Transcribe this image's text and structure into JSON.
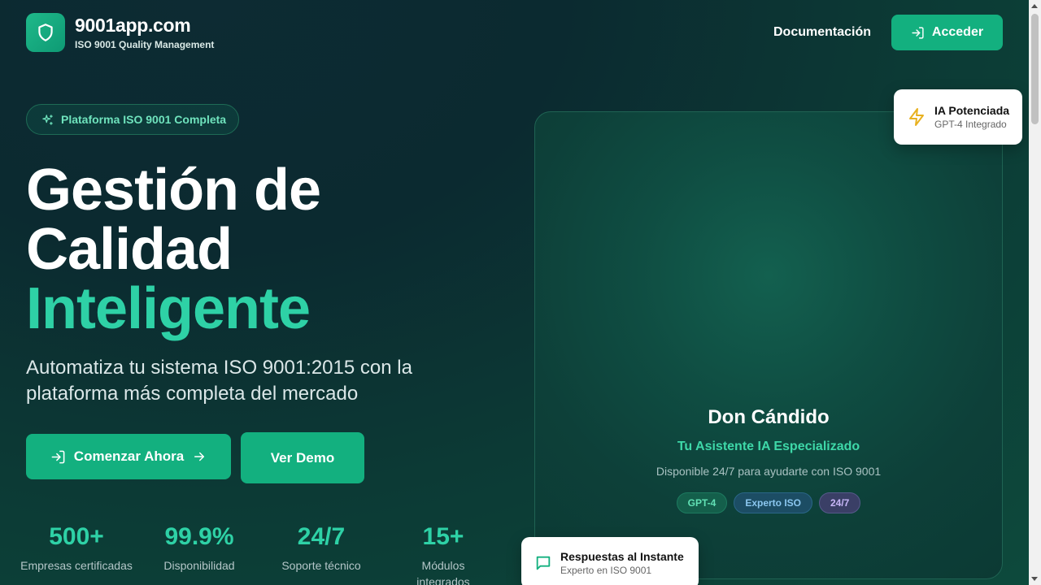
{
  "header": {
    "brand": "9001app.com",
    "brand_sub": "ISO 9001 Quality Management",
    "nav_docs": "Documentación",
    "login": "Acceder"
  },
  "badge": "Plataforma ISO 9001 Completa",
  "hero": {
    "line1": "Gestión de",
    "line2": "Calidad",
    "line3": "Inteligente",
    "description": "Automatiza tu sistema ISO 9001:2015 con la plataforma más completa del mercado",
    "cta_primary": "Comenzar Ahora",
    "cta_secondary": "Ver Demo"
  },
  "stats": [
    {
      "value": "500+",
      "label": "Empresas certificadas"
    },
    {
      "value": "99.9%",
      "label": "Disponibilidad"
    },
    {
      "value": "24/7",
      "label": "Soporte técnico"
    },
    {
      "value": "15+",
      "label": "Módulos integrados"
    }
  ],
  "assistant": {
    "name": "Don Cándido",
    "subtitle": "Tu Asistente IA Especializado",
    "description": "Disponible 24/7 para ayudarte con ISO 9001",
    "tags": [
      "GPT-4",
      "Experto ISO",
      "24/7"
    ]
  },
  "cards": {
    "ia": {
      "title": "IA Potenciada",
      "sub": "GPT-4 Integrado"
    },
    "resp": {
      "title": "Respuestas al Instante",
      "sub": "Experto en ISO 9001"
    }
  },
  "colors": {
    "accent": "#13b07f",
    "highlight": "#2ed1a6",
    "background": "#0c2f33"
  }
}
